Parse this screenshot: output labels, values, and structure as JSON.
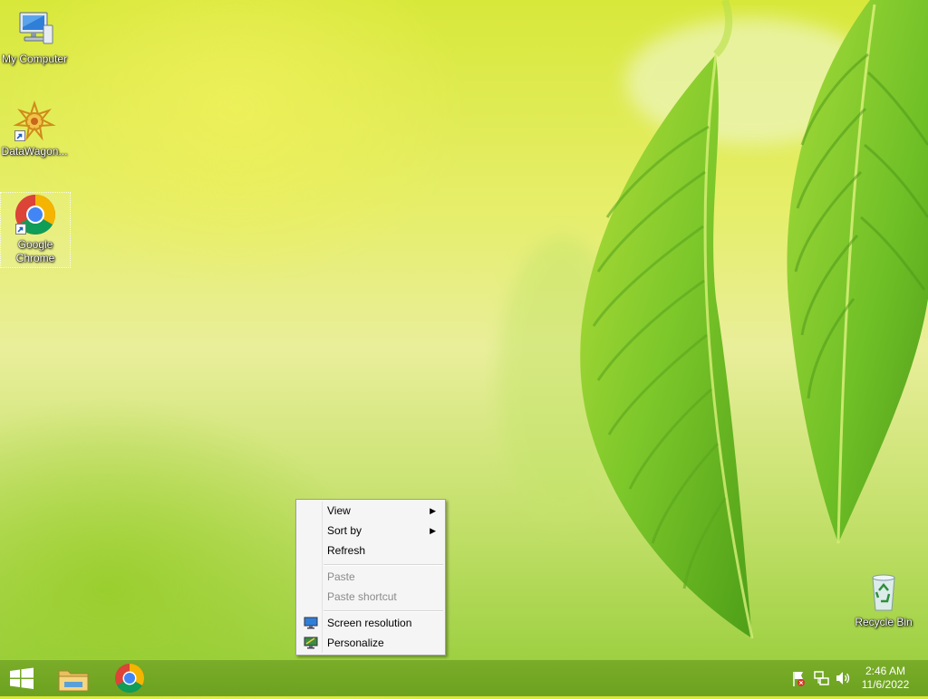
{
  "desktop": {
    "icons": [
      {
        "label": "My Computer",
        "icon": "computer-icon"
      },
      {
        "label": "DataWagon...",
        "icon": "datawagon-icon"
      },
      {
        "label": "Google Chrome",
        "icon": "chrome-icon",
        "selected": true
      },
      {
        "label": "Recycle Bin",
        "icon": "recycle-bin-icon"
      }
    ]
  },
  "context_menu": {
    "items": [
      {
        "label": "View",
        "has_submenu": true,
        "enabled": true
      },
      {
        "label": "Sort by",
        "has_submenu": true,
        "enabled": true
      },
      {
        "label": "Refresh",
        "enabled": true
      },
      {
        "label": "Paste",
        "enabled": false
      },
      {
        "label": "Paste shortcut",
        "enabled": false
      },
      {
        "label": "Screen resolution",
        "icon": "monitor-icon",
        "enabled": true
      },
      {
        "label": "Personalize",
        "icon": "personalize-icon",
        "enabled": true
      }
    ],
    "submenu_glyph": "▶"
  },
  "taskbar": {
    "pinned": [
      "start-button",
      "file-explorer-icon",
      "chrome-icon"
    ],
    "tray_icons": [
      "action-center-flag-icon",
      "network-icon",
      "volume-icon"
    ],
    "clock": {
      "time": "2:46 AM",
      "date": "11/6/2022"
    }
  },
  "colors": {
    "taskbar": "#6fa51f",
    "menu_bg": "#f5f5f5",
    "disabled_text": "#8a8a8a"
  }
}
